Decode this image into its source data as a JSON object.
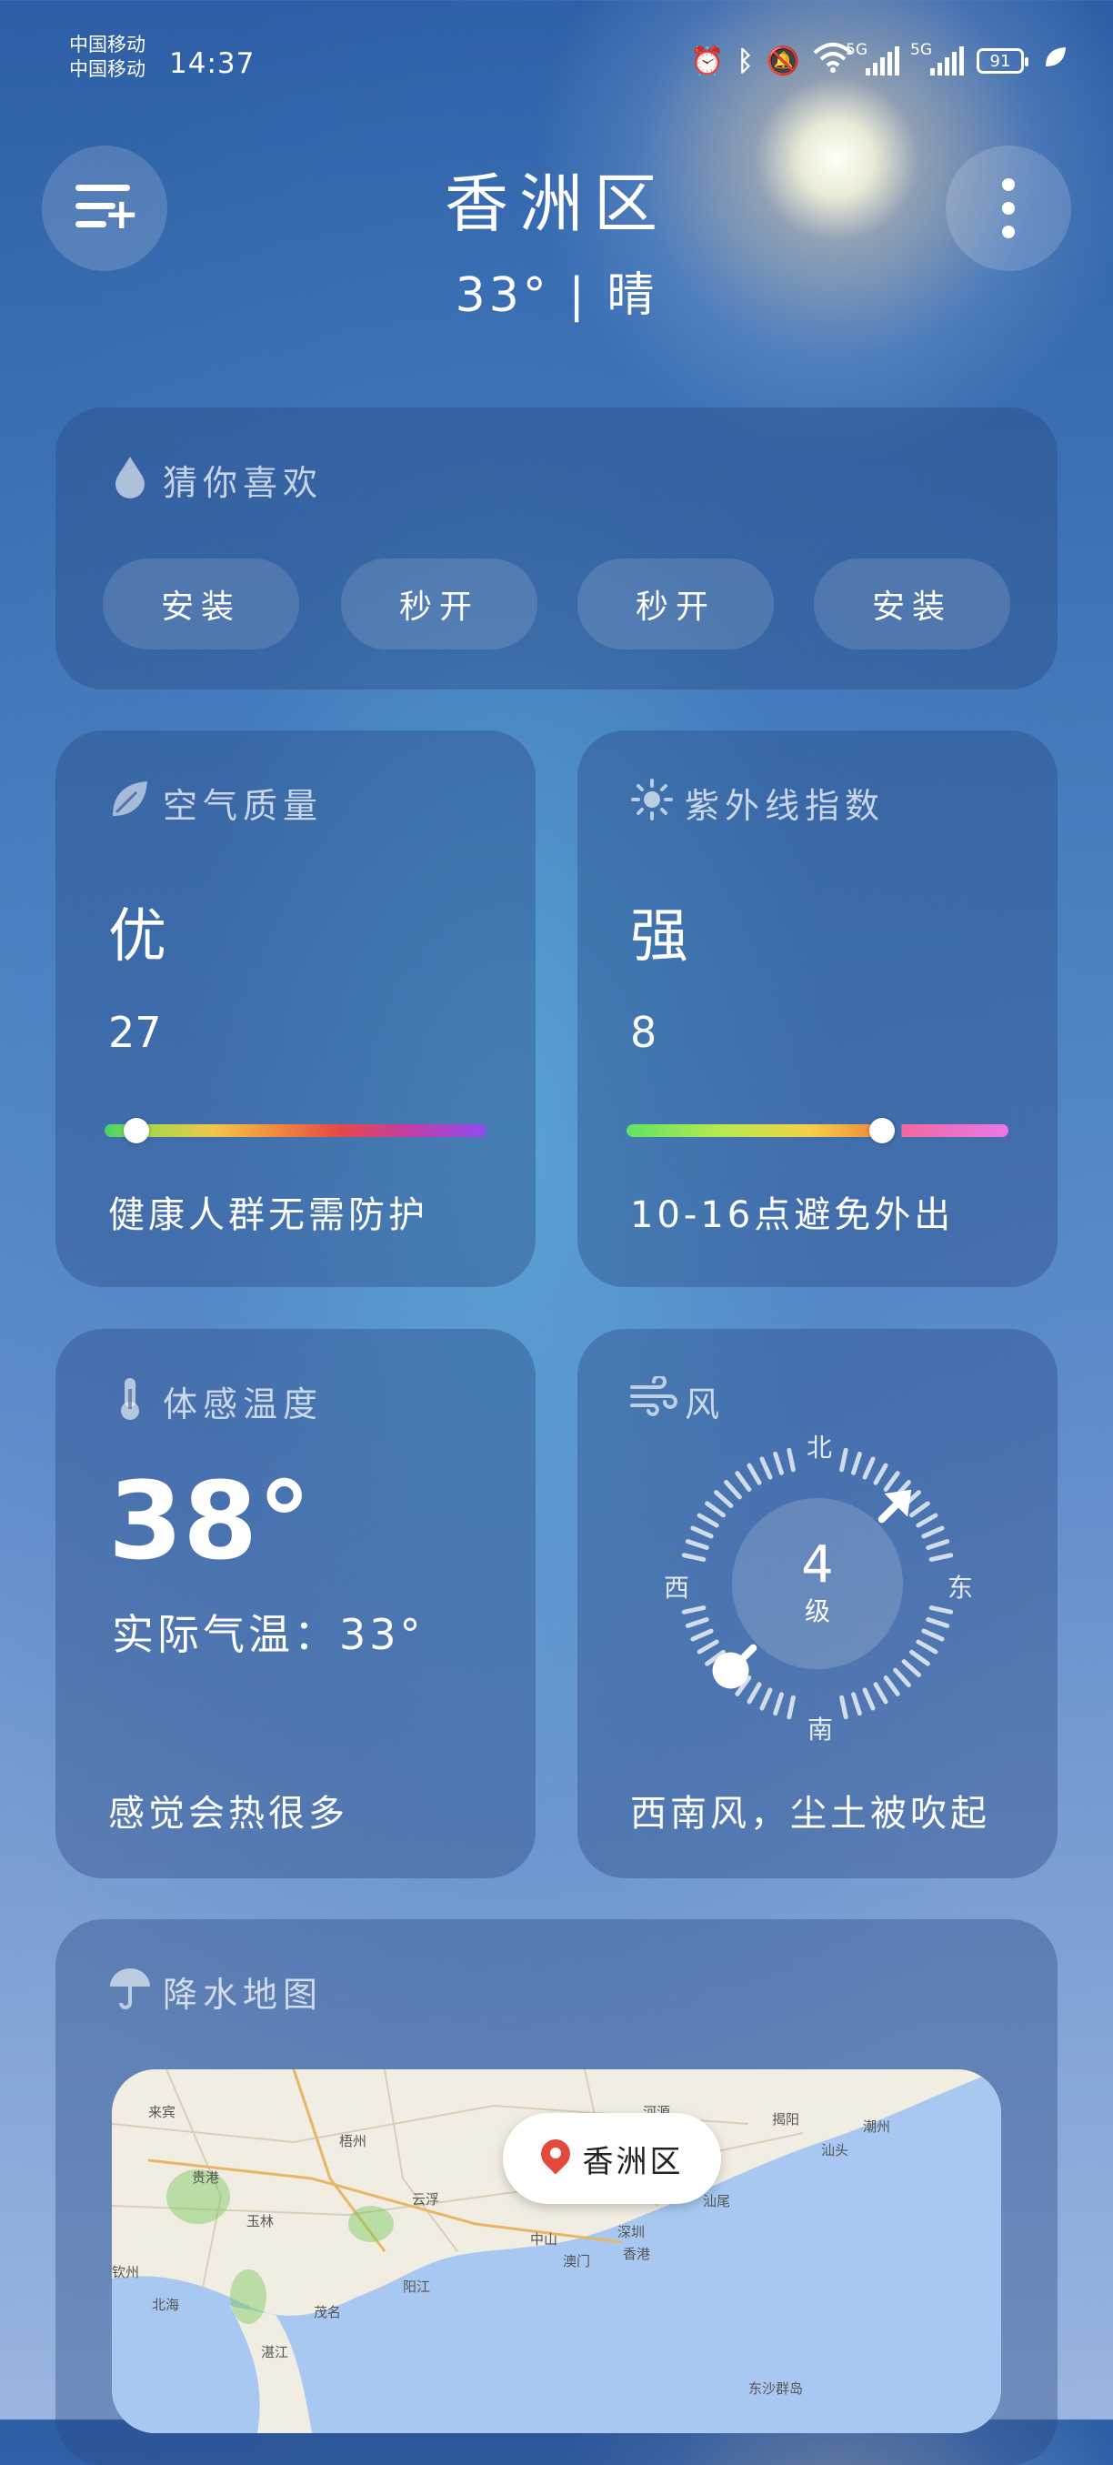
{
  "status_bar": {
    "carrier_1": "中国移动",
    "carrier_2": "中国移动",
    "time": "14:37",
    "network_1": "5G",
    "network_2": "5G",
    "battery": "91",
    "icons": [
      "alarm-icon",
      "bluetooth-icon",
      "mute-icon",
      "wifi-icon",
      "signal-icon",
      "battery-icon",
      "leaf-icon"
    ]
  },
  "header": {
    "city": "香洲区",
    "temperature_weather": "33° | 晴"
  },
  "recommend": {
    "title": "猜你喜欢",
    "chips": [
      "安装",
      "秒开",
      "秒开",
      "安装"
    ]
  },
  "air_quality": {
    "title": "空气质量",
    "level": "优",
    "value": "27",
    "scale_position": 0.05,
    "advice": "健康人群无需防护"
  },
  "uv": {
    "title": "紫外线指数",
    "level": "强",
    "value": "8",
    "scale_position": 0.66,
    "advice": "10-16点避免外出"
  },
  "feels_like": {
    "title": "体感温度",
    "value": "38°",
    "actual": "实际气温：33°",
    "advice": "感觉会热很多"
  },
  "wind": {
    "title": "风",
    "level": "4",
    "unit": "级",
    "north": "北",
    "south": "南",
    "east": "东",
    "west": "西",
    "direction_deg": 225,
    "advice": "西南风，尘土被吹起"
  },
  "precip_map": {
    "title": "降水地图",
    "pin_label": "香洲区",
    "towns": [
      "来宾",
      "贵港",
      "玉林",
      "梧州",
      "云浮",
      "中山",
      "澳门",
      "深圳",
      "香港",
      "茂名",
      "阳江",
      "河源",
      "揭阳",
      "潮州",
      "汕头",
      "汕尾",
      "钦州",
      "北海",
      "湛江",
      "东沙群岛"
    ]
  },
  "colors": {
    "accent_pin": "#e4493e",
    "card_bg": "rgba(40,70,130,0.38)"
  }
}
